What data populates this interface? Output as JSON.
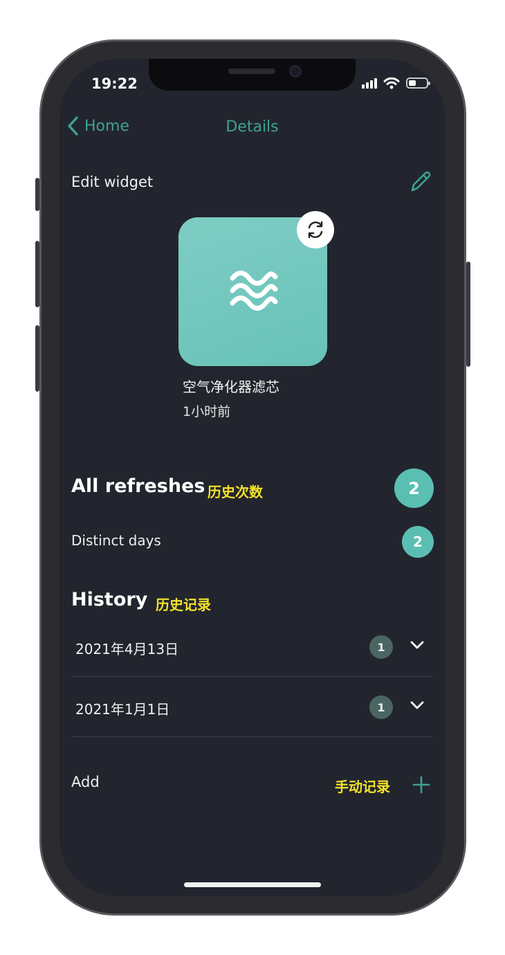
{
  "status_bar": {
    "time": "19:22"
  },
  "nav": {
    "back_label": "Home",
    "title": "Details"
  },
  "edit": {
    "label": "Edit widget"
  },
  "widget": {
    "name": "空气净化器滤芯",
    "last_refresh": "1小时前",
    "color": "#6fc6bc"
  },
  "all_refreshes": {
    "label": "All refreshes",
    "annotation": "历史次数",
    "count": "2"
  },
  "distinct_days": {
    "label": "Distinct days",
    "count": "2"
  },
  "history": {
    "title": "History",
    "annotation": "历史记录",
    "rows": [
      {
        "date": "2021年4月13日",
        "count": "1"
      },
      {
        "date": "2021年1月1日",
        "count": "1"
      }
    ]
  },
  "add": {
    "label": "Add",
    "annotation": "手动记录"
  },
  "colors": {
    "accent": "#3fa192",
    "badge": "#5bbeb3",
    "background": "#22252d",
    "annotation": "#f5e22a"
  }
}
